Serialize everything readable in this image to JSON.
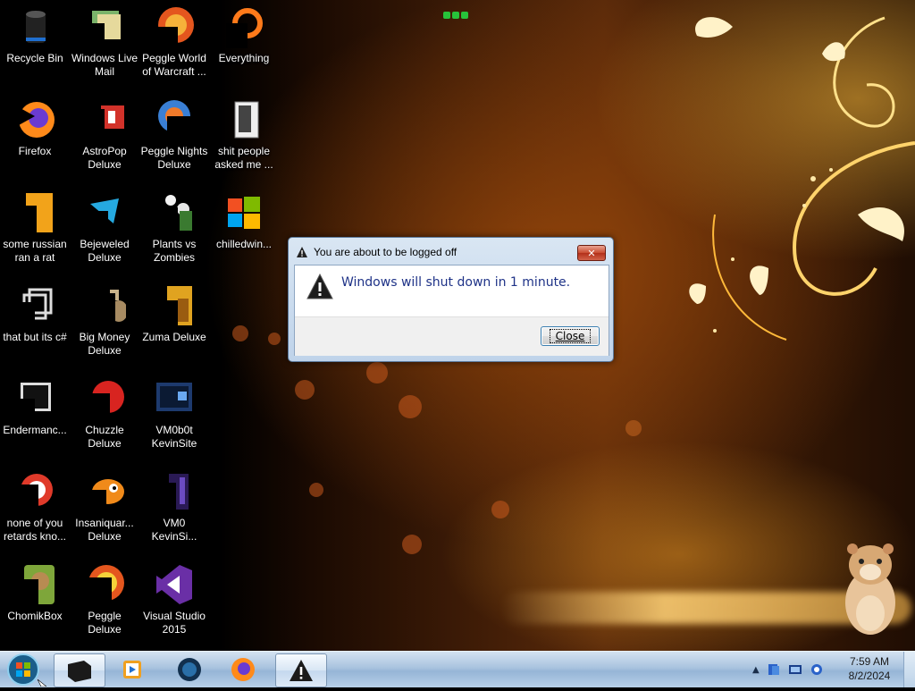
{
  "desktop": {
    "icons": [
      {
        "label": "Recycle Bin",
        "icon": "recycle-bin-icon"
      },
      {
        "label": "Windows Live Mail",
        "icon": "mail-icon"
      },
      {
        "label": "Peggle World of Warcraft ...",
        "icon": "peggle-icon"
      },
      {
        "label": "Everything",
        "icon": "search-app-icon"
      },
      {
        "label": "Firefox",
        "icon": "firefox-icon"
      },
      {
        "label": "AstroPop Deluxe",
        "icon": "astropop-icon"
      },
      {
        "label": "Peggle Nights Deluxe",
        "icon": "peggle-nights-icon"
      },
      {
        "label": "shit people asked me ...",
        "icon": "folder-icon"
      },
      {
        "label": "some russian ran a rat",
        "icon": "file-icon"
      },
      {
        "label": "Bejeweled Deluxe",
        "icon": "bejeweled-icon"
      },
      {
        "label": "Plants vs Zombies",
        "icon": "plants-vs-zombies-icon"
      },
      {
        "label": "chilledwin...",
        "icon": "windows-flag-icon"
      },
      {
        "label": "that but its c#",
        "icon": "shortcut-icon"
      },
      {
        "label": "Big Money Deluxe",
        "icon": "big-money-icon"
      },
      {
        "label": "Zuma Deluxe",
        "icon": "zuma-icon"
      },
      {
        "label": "Endermanc...",
        "icon": "monitor-icon"
      },
      {
        "label": "Chuzzle Deluxe",
        "icon": "chuzzle-icon"
      },
      {
        "label": "VM0b0t KevinSite",
        "icon": "vm-icon"
      },
      {
        "label": "none of you retards kno...",
        "icon": "app-icon"
      },
      {
        "label": "Insaniquar... Deluxe",
        "icon": "insaniquarium-icon"
      },
      {
        "label": "VM0 KevinSi...",
        "icon": "vm2-icon"
      },
      {
        "label": "ChomikBox",
        "icon": "chomikbox-icon"
      },
      {
        "label": "Peggle Deluxe",
        "icon": "peggle-deluxe-icon"
      },
      {
        "label": "Visual Studio 2015",
        "icon": "visual-studio-icon"
      }
    ]
  },
  "dialog": {
    "title": "You are about to be logged off",
    "close_x": "✕",
    "message": "Windows will shut down in 1 minute.",
    "button_label": "Close"
  },
  "taskbar": {
    "items": [
      {
        "name": "explorer-icon",
        "active": true
      },
      {
        "name": "media-player-icon",
        "active": false
      },
      {
        "name": "globe-app-icon",
        "active": false
      },
      {
        "name": "firefox-icon",
        "active": false
      },
      {
        "name": "warning-app-icon",
        "active": true
      }
    ],
    "tray_arrow": "▲",
    "clock_time": "7:59 AM",
    "clock_date": "8/2/2024"
  },
  "colors": {
    "dialog_text": "#1e3287",
    "taskbar": "#a9c3df",
    "close_button_red": "#c94a2f"
  }
}
